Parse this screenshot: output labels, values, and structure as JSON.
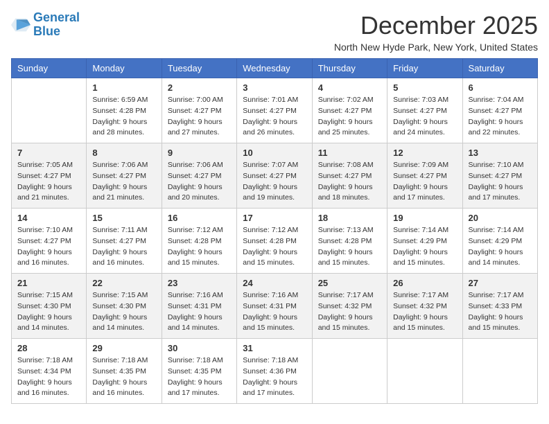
{
  "logo": {
    "line1": "General",
    "line2": "Blue"
  },
  "title": "December 2025",
  "location": "North New Hyde Park, New York, United States",
  "weekdays": [
    "Sunday",
    "Monday",
    "Tuesday",
    "Wednesday",
    "Thursday",
    "Friday",
    "Saturday"
  ],
  "weeks": [
    [
      {
        "day": "",
        "sunrise": "",
        "sunset": "",
        "daylight": ""
      },
      {
        "day": "1",
        "sunrise": "Sunrise: 6:59 AM",
        "sunset": "Sunset: 4:28 PM",
        "daylight": "Daylight: 9 hours and 28 minutes."
      },
      {
        "day": "2",
        "sunrise": "Sunrise: 7:00 AM",
        "sunset": "Sunset: 4:27 PM",
        "daylight": "Daylight: 9 hours and 27 minutes."
      },
      {
        "day": "3",
        "sunrise": "Sunrise: 7:01 AM",
        "sunset": "Sunset: 4:27 PM",
        "daylight": "Daylight: 9 hours and 26 minutes."
      },
      {
        "day": "4",
        "sunrise": "Sunrise: 7:02 AM",
        "sunset": "Sunset: 4:27 PM",
        "daylight": "Daylight: 9 hours and 25 minutes."
      },
      {
        "day": "5",
        "sunrise": "Sunrise: 7:03 AM",
        "sunset": "Sunset: 4:27 PM",
        "daylight": "Daylight: 9 hours and 24 minutes."
      },
      {
        "day": "6",
        "sunrise": "Sunrise: 7:04 AM",
        "sunset": "Sunset: 4:27 PM",
        "daylight": "Daylight: 9 hours and 22 minutes."
      }
    ],
    [
      {
        "day": "7",
        "sunrise": "Sunrise: 7:05 AM",
        "sunset": "Sunset: 4:27 PM",
        "daylight": "Daylight: 9 hours and 21 minutes."
      },
      {
        "day": "8",
        "sunrise": "Sunrise: 7:06 AM",
        "sunset": "Sunset: 4:27 PM",
        "daylight": "Daylight: 9 hours and 21 minutes."
      },
      {
        "day": "9",
        "sunrise": "Sunrise: 7:06 AM",
        "sunset": "Sunset: 4:27 PM",
        "daylight": "Daylight: 9 hours and 20 minutes."
      },
      {
        "day": "10",
        "sunrise": "Sunrise: 7:07 AM",
        "sunset": "Sunset: 4:27 PM",
        "daylight": "Daylight: 9 hours and 19 minutes."
      },
      {
        "day": "11",
        "sunrise": "Sunrise: 7:08 AM",
        "sunset": "Sunset: 4:27 PM",
        "daylight": "Daylight: 9 hours and 18 minutes."
      },
      {
        "day": "12",
        "sunrise": "Sunrise: 7:09 AM",
        "sunset": "Sunset: 4:27 PM",
        "daylight": "Daylight: 9 hours and 17 minutes."
      },
      {
        "day": "13",
        "sunrise": "Sunrise: 7:10 AM",
        "sunset": "Sunset: 4:27 PM",
        "daylight": "Daylight: 9 hours and 17 minutes."
      }
    ],
    [
      {
        "day": "14",
        "sunrise": "Sunrise: 7:10 AM",
        "sunset": "Sunset: 4:27 PM",
        "daylight": "Daylight: 9 hours and 16 minutes."
      },
      {
        "day": "15",
        "sunrise": "Sunrise: 7:11 AM",
        "sunset": "Sunset: 4:27 PM",
        "daylight": "Daylight: 9 hours and 16 minutes."
      },
      {
        "day": "16",
        "sunrise": "Sunrise: 7:12 AM",
        "sunset": "Sunset: 4:28 PM",
        "daylight": "Daylight: 9 hours and 15 minutes."
      },
      {
        "day": "17",
        "sunrise": "Sunrise: 7:12 AM",
        "sunset": "Sunset: 4:28 PM",
        "daylight": "Daylight: 9 hours and 15 minutes."
      },
      {
        "day": "18",
        "sunrise": "Sunrise: 7:13 AM",
        "sunset": "Sunset: 4:28 PM",
        "daylight": "Daylight: 9 hours and 15 minutes."
      },
      {
        "day": "19",
        "sunrise": "Sunrise: 7:14 AM",
        "sunset": "Sunset: 4:29 PM",
        "daylight": "Daylight: 9 hours and 15 minutes."
      },
      {
        "day": "20",
        "sunrise": "Sunrise: 7:14 AM",
        "sunset": "Sunset: 4:29 PM",
        "daylight": "Daylight: 9 hours and 14 minutes."
      }
    ],
    [
      {
        "day": "21",
        "sunrise": "Sunrise: 7:15 AM",
        "sunset": "Sunset: 4:30 PM",
        "daylight": "Daylight: 9 hours and 14 minutes."
      },
      {
        "day": "22",
        "sunrise": "Sunrise: 7:15 AM",
        "sunset": "Sunset: 4:30 PM",
        "daylight": "Daylight: 9 hours and 14 minutes."
      },
      {
        "day": "23",
        "sunrise": "Sunrise: 7:16 AM",
        "sunset": "Sunset: 4:31 PM",
        "daylight": "Daylight: 9 hours and 14 minutes."
      },
      {
        "day": "24",
        "sunrise": "Sunrise: 7:16 AM",
        "sunset": "Sunset: 4:31 PM",
        "daylight": "Daylight: 9 hours and 15 minutes."
      },
      {
        "day": "25",
        "sunrise": "Sunrise: 7:17 AM",
        "sunset": "Sunset: 4:32 PM",
        "daylight": "Daylight: 9 hours and 15 minutes."
      },
      {
        "day": "26",
        "sunrise": "Sunrise: 7:17 AM",
        "sunset": "Sunset: 4:32 PM",
        "daylight": "Daylight: 9 hours and 15 minutes."
      },
      {
        "day": "27",
        "sunrise": "Sunrise: 7:17 AM",
        "sunset": "Sunset: 4:33 PM",
        "daylight": "Daylight: 9 hours and 15 minutes."
      }
    ],
    [
      {
        "day": "28",
        "sunrise": "Sunrise: 7:18 AM",
        "sunset": "Sunset: 4:34 PM",
        "daylight": "Daylight: 9 hours and 16 minutes."
      },
      {
        "day": "29",
        "sunrise": "Sunrise: 7:18 AM",
        "sunset": "Sunset: 4:35 PM",
        "daylight": "Daylight: 9 hours and 16 minutes."
      },
      {
        "day": "30",
        "sunrise": "Sunrise: 7:18 AM",
        "sunset": "Sunset: 4:35 PM",
        "daylight": "Daylight: 9 hours and 17 minutes."
      },
      {
        "day": "31",
        "sunrise": "Sunrise: 7:18 AM",
        "sunset": "Sunset: 4:36 PM",
        "daylight": "Daylight: 9 hours and 17 minutes."
      },
      {
        "day": "",
        "sunrise": "",
        "sunset": "",
        "daylight": ""
      },
      {
        "day": "",
        "sunrise": "",
        "sunset": "",
        "daylight": ""
      },
      {
        "day": "",
        "sunrise": "",
        "sunset": "",
        "daylight": ""
      }
    ]
  ]
}
